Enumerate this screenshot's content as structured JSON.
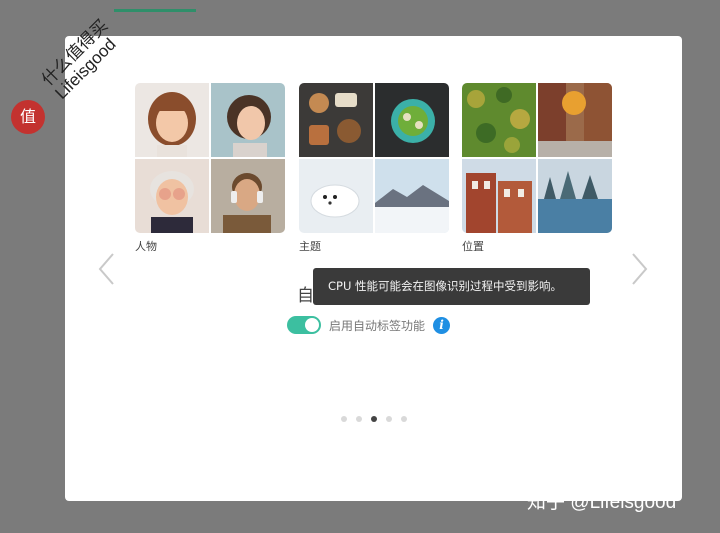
{
  "watermark": {
    "badge_char": "值",
    "line1": "什么值得买",
    "line2": "Lifeisgood"
  },
  "categories": [
    {
      "label": "人物",
      "thumbnails": [
        "child-portrait",
        "woman-portrait",
        "elderly-woman-portrait",
        "man-with-headphones"
      ]
    },
    {
      "label": "主题",
      "thumbnails": [
        "food-flatlay",
        "salad-bowl",
        "seal-on-snow",
        "snowy-mountains"
      ]
    },
    {
      "label": "位置",
      "thumbnails": [
        "forest-aerial",
        "autumn-street",
        "brick-buildings",
        "frozen-lake"
      ]
    }
  ],
  "heading": "自动分类您的照片！",
  "toggle": {
    "label": "启用自动标签功能",
    "state": "on"
  },
  "tooltip": "CPU 性能可能会在图像识别过程中受到影响。",
  "pagination": {
    "total": 5,
    "active_index": 2
  },
  "footer_watermark": "知乎 @Lifeisgood",
  "colors": {
    "accent": "#3cbfa0",
    "info": "#1f8fe3",
    "tooltip_bg": "#3a3a3a"
  }
}
